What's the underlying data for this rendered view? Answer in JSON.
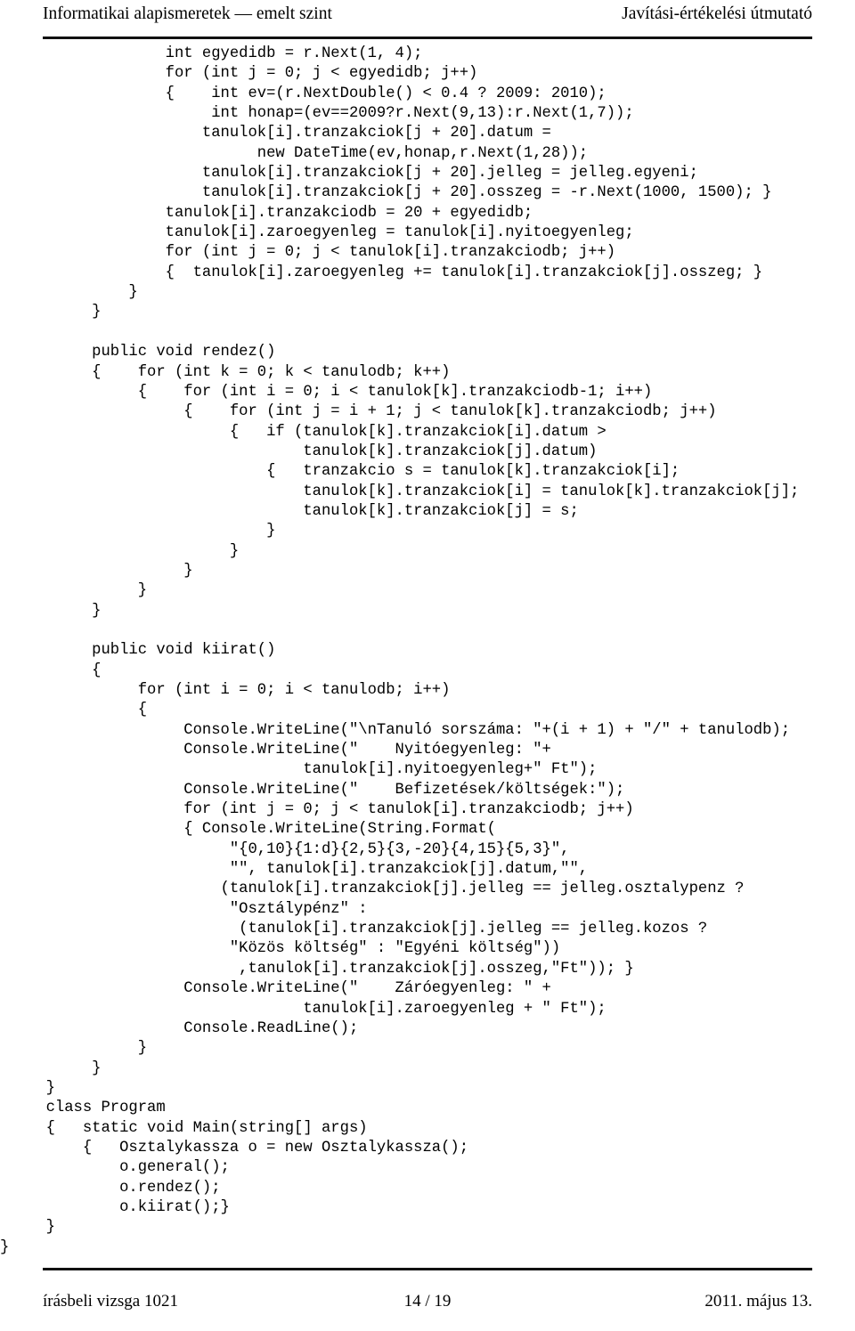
{
  "header": {
    "left_title": "Informatikai alapismeretek — emelt szint",
    "right_title": "Javítási-értékelési útmutató"
  },
  "footer": {
    "left": "írásbeli vizsga 1021",
    "center": "14 / 19",
    "right": "2011. május 13."
  },
  "colors": {
    "page_background": "#ffffff",
    "text": "#000000",
    "rule": "#111111"
  },
  "code": {
    "language": "csharp",
    "lines": [
      "                  int egyedidb = r.Next(1, 4);",
      "                  for (int j = 0; j < egyedidb; j++)",
      "                  {    int ev=(r.NextDouble() < 0.4 ? 2009: 2010);",
      "                       int honap=(ev==2009?r.Next(9,13):r.Next(1,7));",
      "                      tanulok[i].tranzakciok[j + 20].datum =",
      "                            new DateTime(ev,honap,r.Next(1,28));",
      "                      tanulok[i].tranzakciok[j + 20].jelleg = jelleg.egyeni;",
      "                      tanulok[i].tranzakciok[j + 20].osszeg = -r.Next(1000, 1500); }",
      "                  tanulok[i].tranzakciodb = 20 + egyedidb;",
      "                  tanulok[i].zaroegyenleg = tanulok[i].nyitoegyenleg;",
      "                  for (int j = 0; j < tanulok[i].tranzakciodb; j++)",
      "                  {  tanulok[i].zaroegyenleg += tanulok[i].tranzakciok[j].osszeg; }",
      "              }",
      "          }",
      "",
      "          public void rendez()",
      "          {    for (int k = 0; k < tanulodb; k++)",
      "               {    for (int i = 0; i < tanulok[k].tranzakciodb-1; i++)",
      "                    {    for (int j = i + 1; j < tanulok[k].tranzakciodb; j++)",
      "                         {   if (tanulok[k].tranzakciok[i].datum >",
      "                                 tanulok[k].tranzakciok[j].datum)",
      "                             {   tranzakcio s = tanulok[k].tranzakciok[i];",
      "                                 tanulok[k].tranzakciok[i] = tanulok[k].tranzakciok[j];",
      "                                 tanulok[k].tranzakciok[j] = s;",
      "                             }",
      "                         }",
      "                    }",
      "               }",
      "          }",
      "",
      "          public void kiirat()",
      "          {",
      "               for (int i = 0; i < tanulodb; i++)",
      "               {",
      "                    Console.WriteLine(\"\\nTanuló sorszáma: \"+(i + 1) + \"/\" + tanulodb);",
      "                    Console.WriteLine(\"    Nyitóegyenleg: \"+",
      "                                 tanulok[i].nyitoegyenleg+\" Ft\");",
      "                    Console.WriteLine(\"    Befizetések/költségek:\");",
      "                    for (int j = 0; j < tanulok[i].tranzakciodb; j++)",
      "                    { Console.WriteLine(String.Format(",
      "                         \"{0,10}{1:d}{2,5}{3,-20}{4,15}{5,3}\",",
      "                         \"\", tanulok[i].tranzakciok[j].datum,\"\",",
      "                        (tanulok[i].tranzakciok[j].jelleg == jelleg.osztalypenz ?",
      "                         \"Osztálypénz\" :",
      "                          (tanulok[i].tranzakciok[j].jelleg == jelleg.kozos ?",
      "                         \"Közös költség\" : \"Egyéni költség\"))",
      "                          ,tanulok[i].tranzakciok[j].osszeg,\"Ft\")); }",
      "                    Console.WriteLine(\"    Záróegyenleg: \" +",
      "                                 tanulok[i].zaroegyenleg + \" Ft\");",
      "                    Console.ReadLine();",
      "               }",
      "          }",
      "     }",
      "     class Program",
      "     {   static void Main(string[] args)",
      "         {   Osztalykassza o = new Osztalykassza();",
      "             o.general();",
      "             o.rendez();",
      "             o.kiirat();}",
      "     }",
      "}"
    ]
  }
}
